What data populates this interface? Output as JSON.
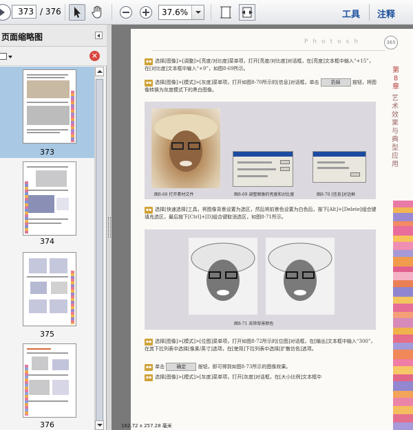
{
  "toolbar": {
    "page_current": "373",
    "page_total": "/ 376",
    "zoom": "37.6%",
    "tools_label": "工具",
    "comment_label": "注释"
  },
  "sidebar": {
    "title": "页面缩略图",
    "thumbnails": [
      {
        "label": "373",
        "selected": true
      },
      {
        "label": "374",
        "selected": false
      },
      {
        "label": "375",
        "selected": false
      },
      {
        "label": "376",
        "selected": false
      }
    ]
  },
  "page": {
    "header_word": "Photosh",
    "page_number": "365",
    "chapter": "第8章",
    "side_title": "艺术效果与典型应用",
    "paragraphs": {
      "p1": "选择[图像]>[调整]>[亮度/对比度]菜单项，打开[亮度/对比度]对话框，在[亮度]文本框中输入“+15”，在[对比度]文本框中输入“+9”，如图8-69所示。",
      "p2": "选择[图像]>[模式]>[灰度]菜单项，打开如图8-70所示的[信息]对话框，单击",
      "p2_button": "扔掉",
      "p2_tail": "按钮，将图像转换为灰度模式下的黑白图像。",
      "p3": "选择[快速选择]工具，将图像背景设置为选区，然后将前景色设置为白色后，按下[Alt]+[Delete]组合键填充选区，最后按下[Ctrl]+[D]组合键取消选区，如图8-71所示。",
      "p4": "选择[图像]>[模式]>[位图]菜单项，打开如图8-72所示的[位图]对话框，在[输出]文本框中输入“300”，在其下拉列表中选择[像素/英寸]选项，在[使用]下拉列表中选择[扩散仿色]选项。",
      "p5": "单击",
      "p5_button": "确定",
      "p5_tail": "按钮，即可得到如图8-73所示的图像效果。",
      "p6": "选择[图像]>[模式]>[灰度]菜单项，打开[灰度]对话框，在[大小比例]文本框中"
    },
    "captions": {
      "fig68": "图8-68  打开素材文件",
      "fig69": "图8-69  调整图像的亮度和对比度",
      "fig70": "图8-70  [信息]对话框",
      "fig71": "图8-71  去除背景颜色"
    }
  },
  "status": {
    "size_text": "182.72 x 257.28 毫米"
  },
  "colors": {
    "accent": "#1c4f9c",
    "step_tag": "#d1a23a",
    "selected_thumb": "#a9c8e3"
  }
}
